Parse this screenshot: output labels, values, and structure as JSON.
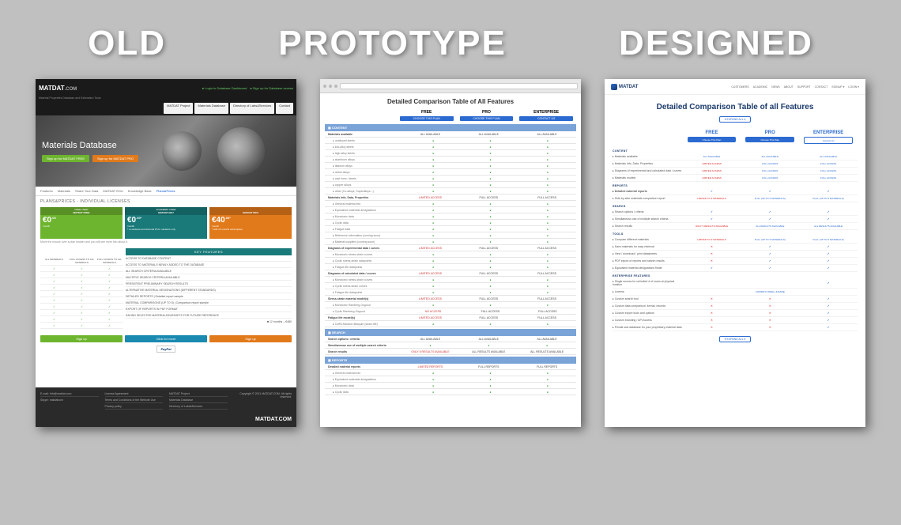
{
  "labels": {
    "old": "OLD",
    "prototype": "PROTOTYPE",
    "designed": "DESIGNED"
  },
  "old": {
    "brand": "MATDAT",
    "brand_suffix": ".COM",
    "tagline": "Material Properties Database and Estimation Tools",
    "top_links": [
      "Login to Database Dashboard",
      "Sign up for Database access"
    ],
    "nav_tabs": [
      "MATDAT Project",
      "Materials Database",
      "Directory of Labs&Services",
      "Contact"
    ],
    "hero_title": "Materials Database",
    "hero_btn_free": "Sign up for MATDAT FREE",
    "hero_btn_pro": "Sign up for MATDAT PRO",
    "secondary_tabs": [
      "Features",
      "Materials",
      "Share Your Data",
      "MATDAT EDU",
      "Knowledge Base",
      "Plans&Prices"
    ],
    "page_heading": "PLANS&PRICES - INDIVIDUAL LICENSES",
    "hover_hint": "Move the mouse over a plan header and you will see more info about it.",
    "plans": [
      {
        "tag": "FREE USER",
        "name": "MATDAT FREE",
        "price": "€0",
        "cents": ".00",
        "period": "/month",
        "access": "ALL MATERIALS"
      },
      {
        "tag": "ACADEMIC USER",
        "name": "MATDAT EDU",
        "price": "€0",
        "cents": ".00*",
        "period": "/month",
        "note": "* to students and doctoral Ph.D. students only",
        "access": "FULL ACCESS TO ALL MATERIALS"
      },
      {
        "tag": "",
        "name": "MATDAT PRO",
        "price": "€40",
        "cents": ".00*",
        "period": "/month",
        "note": "* with 12 months subscription",
        "access": "FULL ACCESS TO ALL MATERIALS"
      }
    ],
    "kf_header": "KEY FEATURES",
    "features": [
      "ACCESS TO DATABASE CONTENT",
      "ACCESS TO MATERIALS NEWLY ADDED TO THE DATABASE",
      "ALL SEARCH CRITERIA AVAILABLE",
      "MULTIPLE SEARCH CRITERIA AVAILABLE",
      "PERSISTENT PRELIMINARY SEARCH RESULTS",
      "ALTERNATIVE MATERIAL DESIGNATIONS (DIFFERENT STANDARDS)",
      "DETAILED REPORTS | Detailed report sample",
      "MATERIAL COMPARISONS (UP TO 5) | Comparison report sample",
      "EXPORT OF REPORTS IN PDF FORMAT",
      "SAVING SELECTED MATERIALS/DATASETS FOR FUTURE REFERENCE"
    ],
    "pricing_note": "12 months – €480",
    "cta": [
      "Sign up",
      "Click for more",
      "Sign up"
    ],
    "paypal": "PayPal",
    "footer": {
      "email_label": "E-mail:",
      "email": "info@matdat.com",
      "skype_label": "Skype:",
      "skype": "matdatcom",
      "links_col1": [
        "License Agreement",
        "Terms and Conditions of the Website Use",
        "Privacy policy"
      ],
      "links_col2": [
        "MATDAT Project",
        "Materials Database",
        "Directory of Labs&Services"
      ],
      "links_col3": [
        "Contact"
      ],
      "copyright": "Copyright © 2011 MATDAT.COM. All rights reserved.",
      "brand": "MATDAT.COM"
    }
  },
  "prototype": {
    "title": "Detailed Comparison Table of All Features",
    "plans": [
      "FREE",
      "PRO",
      "ENTERPRISE"
    ],
    "plan_btns": [
      "CHOOSE THIS PLAN",
      "CHOOSE THIS PLAN",
      "CONTACT US"
    ],
    "sections": [
      {
        "name": "CONTENT",
        "rows": [
          {
            "n": "Materials available",
            "bold": true,
            "v": [
              "ALL AVAILABLE",
              "ALL AVAILABLE",
              "ALL AVAILABLE"
            ],
            "vt": "t"
          },
          {
            "n": "unalloyed steels",
            "sub": true,
            "v": [
              "g",
              "g",
              "g"
            ]
          },
          {
            "n": "low-alloy steels",
            "sub": true,
            "v": [
              "g",
              "g",
              "g"
            ]
          },
          {
            "n": "high-alloy steels",
            "sub": true,
            "v": [
              "g",
              "g",
              "g"
            ]
          },
          {
            "n": "aluminum alloys",
            "sub": true,
            "v": [
              "g",
              "g",
              "g"
            ]
          },
          {
            "n": "titanium alloys",
            "sub": true,
            "v": [
              "g",
              "g",
              "g"
            ]
          },
          {
            "n": "nickel alloys",
            "sub": true,
            "v": [
              "g",
              "g",
              "g"
            ]
          },
          {
            "n": "cast irons / steels",
            "sub": true,
            "v": [
              "g",
              "g",
              "g"
            ]
          },
          {
            "n": "copper alloys",
            "sub": true,
            "v": [
              "g",
              "g",
              "g"
            ]
          },
          {
            "n": "other (Co-alloys, Superalloys...)",
            "sub": true,
            "v": [
              "g",
              "g",
              "g"
            ]
          },
          {
            "n": "Materials Info, Data, Properties",
            "bold": true,
            "v": [
              "LIMITED ACCESS",
              "FULL ACCESS",
              "FULL ACCESS"
            ],
            "vt": "t",
            "lim": 1
          },
          {
            "n": "General material info",
            "sub": true,
            "v": [
              "g",
              "g",
              "g"
            ]
          },
          {
            "n": "Equivalent materials designations",
            "sub": true,
            "v": [
              "g",
              "g",
              "g"
            ]
          },
          {
            "n": "Monotonic data",
            "sub": true,
            "v": [
              "g",
              "g",
              "g"
            ]
          },
          {
            "n": "Cyclic data",
            "sub": true,
            "v": [
              "g",
              "g",
              "g"
            ]
          },
          {
            "n": "Fatigue data",
            "sub": true,
            "v": [
              "g",
              "g",
              "g"
            ]
          },
          {
            "n": "Reference information (coming soon)",
            "sub": true,
            "v": [
              "g",
              "g",
              "g"
            ]
          },
          {
            "n": "Material suppliers (coming soon)",
            "sub": true,
            "v": [
              "g",
              "g",
              "g"
            ]
          },
          {
            "n": "Diagrams of experimental data / curves",
            "bold": true,
            "v": [
              "LIMITED ACCESS",
              "FULL ACCESS",
              "FULL ACCESS"
            ],
            "vt": "t",
            "lim": 1
          },
          {
            "n": "Monotonic stress-strain curves",
            "sub": true,
            "v": [
              "g",
              "g",
              "g"
            ]
          },
          {
            "n": "Cyclic stress-strain datapoints",
            "sub": true,
            "v": [
              "g",
              "g",
              "g"
            ]
          },
          {
            "n": "Fatigue-life datapoints",
            "sub": true,
            "v": [
              "g",
              "g",
              "g"
            ]
          },
          {
            "n": "Diagrams of calculated data / curves",
            "bold": true,
            "v": [
              "LIMITED ACCESS",
              "FULL ACCESS",
              "FULL ACCESS"
            ],
            "vt": "t",
            "lim": 1
          },
          {
            "n": "Monotonic stress-strain curves",
            "sub": true,
            "v": [
              "g",
              "g",
              "g"
            ]
          },
          {
            "n": "Cyclic stress-strain curves",
            "sub": true,
            "v": [
              "g",
              "g",
              "g"
            ]
          },
          {
            "n": "Fatigue-life datapoints",
            "sub": true,
            "v": [
              "g",
              "g",
              "g"
            ]
          },
          {
            "n": "Stress-strain material model(s)",
            "bold": true,
            "v": [
              "LIMITED ACCESS",
              "FULL ACCESS",
              "FULL ACCESS"
            ],
            "vt": "t",
            "lim": 1
          },
          {
            "n": "Monotonic Ramberg-Osgood",
            "sub": true,
            "v": [
              "g",
              "g",
              "g"
            ]
          },
          {
            "n": "Cyclic Ramberg-Osgood",
            "sub": true,
            "v": [
              "NO ACCESS",
              "FULL ACCESS",
              "FULL ACCESS"
            ],
            "vt": "t",
            "lim": 1
          },
          {
            "n": "Fatigue life model(s)",
            "bold": true,
            "v": [
              "LIMITED ACCESS",
              "FULL ACCESS",
              "FULL ACCESS"
            ],
            "vt": "t",
            "lim": 1
          },
          {
            "n": "Coffin-Manson-Basquin (strain-life)",
            "sub": true,
            "v": [
              "g",
              "g",
              "g"
            ]
          }
        ]
      },
      {
        "name": "SEARCH",
        "rows": [
          {
            "n": "Search options / criteria",
            "bold": true,
            "v": [
              "ALL AVAILABLE",
              "ALL AVAILABLE",
              "ALL AVAILABLE"
            ],
            "vt": "t"
          },
          {
            "n": "Simultaneous use of multiple search criteria",
            "bold": true,
            "v": [
              "g",
              "g",
              "g"
            ]
          },
          {
            "n": "Search results",
            "bold": true,
            "v": [
              "ONLY 5 RESULTS AVAILABLE",
              "ALL RESULTS AVAILABLE",
              "ALL RESULTS AVAILABLE"
            ],
            "vt": "t",
            "lim": 1
          }
        ]
      },
      {
        "name": "REPORTS",
        "rows": [
          {
            "n": "Detailed material reports",
            "bold": true,
            "v": [
              "LIMITED REPORTS",
              "FULL REPORTS",
              "FULL REPORTS"
            ],
            "vt": "t",
            "lim": 1
          },
          {
            "n": "General material info",
            "sub": true,
            "v": [
              "g",
              "g",
              "g"
            ]
          },
          {
            "n": "Equivalent materials designations",
            "sub": true,
            "v": [
              "g",
              "g",
              "g"
            ]
          },
          {
            "n": "Monotonic data",
            "sub": true,
            "v": [
              "g",
              "g",
              "g"
            ]
          },
          {
            "n": "Cyclic data",
            "sub": true,
            "v": [
              "g",
              "g",
              "g"
            ]
          }
        ]
      }
    ]
  },
  "designed": {
    "brand": "MATDAT",
    "nav": [
      "CUSTOMERS",
      "ACADEMIC",
      "NEWS",
      "ABOUT",
      "SUPPORT",
      "CONTACT",
      "SIGNUP ▾",
      "LOGIN ▾"
    ],
    "title": "Detailed Comparison Table of all Features",
    "expand": "▾ EXPAND ALL ▾",
    "plans": [
      "FREE",
      "PRO",
      "ENTERPRISE"
    ],
    "plan_btns": [
      "Choose This Plan",
      "Choose This Plan",
      "Contact Us"
    ],
    "sections": [
      {
        "name": "CONTENT",
        "rows": [
          {
            "n": "Materials available",
            "v": [
              "ALL AVAILABLE",
              "ALL AVAILABLE",
              "ALL AVAILABLE"
            ],
            "vt": "t"
          },
          {
            "n": "Materials Info, Data, Properties",
            "v": [
              "LIMITED ACCESS",
              "FULL ACCESS",
              "FULL ACCESS"
            ],
            "vt": "t",
            "lim": 1
          },
          {
            "n": "Diagrams of experimental and calculated data / curves",
            "v": [
              "LIMITED ACCESS",
              "FULL ACCESS",
              "FULL ACCESS"
            ],
            "vt": "t",
            "lim": 1
          },
          {
            "n": "Materials models",
            "v": [
              "LIMITED ACCESS",
              "FULL ACCESS",
              "FULL ACCESS"
            ],
            "vt": "t",
            "lim": 1
          }
        ]
      },
      {
        "name": "REPORTS",
        "rows": [
          {
            "n": "Detailed material reports",
            "bold": true,
            "v": [
              "c",
              "c",
              "c"
            ]
          },
          {
            "n": "Side-by-side materials comparison report",
            "v": [
              "LIMITED TO 3 MATERIALS",
              "FULL (UP TO 5 MATERIALS)",
              "FULL (UP TO 5 MATERIALS)"
            ],
            "vt": "t",
            "lim": 1
          }
        ]
      },
      {
        "name": "SEARCH",
        "rows": [
          {
            "n": "Search options / criteria",
            "v": [
              "c",
              "c",
              "c"
            ]
          },
          {
            "n": "Simultaneous use of multiple search criteria",
            "v": [
              "c",
              "c",
              "c"
            ]
          },
          {
            "n": "Search results",
            "v": [
              "ONLY 5 RESULTS AVAILABLE",
              "ALL RESULTS AVAILABLE",
              "ALL RESULTS AVAILABLE"
            ],
            "vt": "t",
            "lim": 1
          }
        ]
      },
      {
        "name": "TOOLS",
        "rows": [
          {
            "n": "Compare different materials",
            "v": [
              "LIMITED TO 3 MATERIALS",
              "FULL (UP TO 5 MATERIALS)",
              "FULL (UP TO 5 MATERIALS)"
            ],
            "vt": "t",
            "lim": 1
          },
          {
            "n": "Save materials for easy retrieval",
            "v": [
              "x",
              "c",
              "c"
            ]
          },
          {
            "n": "View / download / print datasheets",
            "v": [
              "x",
              "c",
              "c"
            ]
          },
          {
            "n": "PDF export of reports and search results",
            "v": [
              "x",
              "c",
              "c"
            ]
          },
          {
            "n": "Equivalent material designations finder",
            "v": [
              "c",
              "c",
              "c"
            ]
          }
        ]
      },
      {
        "name": "ENTERPRISE FEATURES",
        "rows": [
          {
            "n": "Single access for unlimited # of users at physical location",
            "v": [
              "",
              "",
              "c"
            ]
          },
          {
            "n": "License",
            "v": [
              "",
              "COMPANY-WIDE LICENSE",
              ""
            ],
            "vt": "t"
          },
          {
            "n": "Custom search tool",
            "v": [
              "x",
              "x",
              "c"
            ]
          },
          {
            "n": "Custom data comparison: format, records",
            "v": [
              "x",
              "x",
              "c"
            ]
          },
          {
            "n": "Custom export tools and options",
            "v": [
              "x",
              "x",
              "c"
            ]
          },
          {
            "n": "Custom branding / API Access",
            "v": [
              "x",
              "x",
              "c"
            ]
          },
          {
            "n": "Private sub-database for your proprietary material data",
            "v": [
              "x",
              "x",
              "c"
            ]
          }
        ]
      }
    ]
  }
}
